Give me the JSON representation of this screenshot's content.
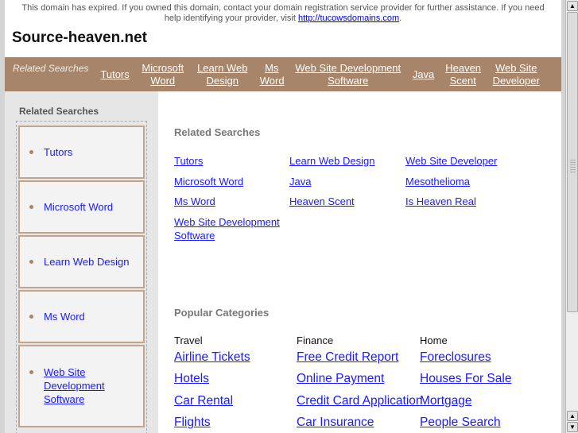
{
  "notice": {
    "text": "This domain has expired. If you owned this domain, contact your domain registration service provider for further assistance. If you need help identifying your provider, visit ",
    "link": "http://tucowsdomains.com",
    "end": "."
  },
  "site_title": "Source-heaven.net",
  "topbar": {
    "label": "Related Searches",
    "links": [
      "Tutors",
      "Microsoft Word",
      "Learn Web Design",
      "Ms Word",
      "Web Site Development Software",
      "Java",
      "Heaven Scent",
      "Web Site Developer"
    ]
  },
  "sidebar": {
    "heading": "Related Searches",
    "items": [
      "Tutors",
      "Microsoft Word",
      "Learn Web Design",
      "Ms Word",
      "Web Site Development Software"
    ]
  },
  "related": {
    "heading": "Related Searches",
    "columns": [
      [
        "Tutors",
        "Microsoft Word",
        "Ms Word",
        "Web Site Development Software"
      ],
      [
        "Learn Web Design",
        "Java",
        "Heaven Scent"
      ],
      [
        "Web Site Developer",
        "Mesothelioma",
        "Is Heaven Real"
      ]
    ]
  },
  "popular": {
    "heading": "Popular Categories",
    "categories": [
      {
        "name": "Travel",
        "links": [
          "Airline Tickets",
          "Hotels",
          "Car Rental",
          "Flights"
        ]
      },
      {
        "name": "Finance",
        "links": [
          "Free Credit Report",
          "Online Payment",
          "Credit Card Application",
          "Car Insurance"
        ]
      },
      {
        "name": "Home",
        "links": [
          "Foreclosures",
          "Houses For Sale",
          "Mortgage",
          "People Search"
        ]
      }
    ]
  },
  "colors": {
    "bar": "#a6856a",
    "link": "#1a1aff"
  }
}
